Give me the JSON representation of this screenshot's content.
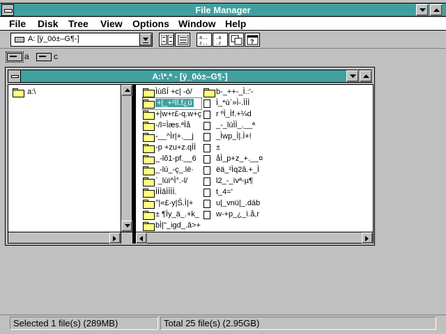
{
  "app": {
    "title": "File Manager",
    "colors": {
      "titlebar": "#40a0a0",
      "face": "#c0c0c0",
      "selection": "#40a0a0"
    }
  },
  "menu": [
    "File",
    "Disk",
    "Tree",
    "View",
    "Options",
    "Window",
    "Help"
  ],
  "toolbar": {
    "drive_select_value": "A: [ÿ_0ó±–G¶-]",
    "buttons": [
      {
        "icon": "view-tree-directory-icon"
      },
      {
        "icon": "view-directory-only-icon"
      },
      {
        "icon": "sort-by-name-icon"
      },
      {
        "icon": "sort-by-type-icon"
      },
      {
        "icon": "new-window-icon"
      },
      {
        "icon": "view-all-file-details-icon"
      }
    ]
  },
  "drives": [
    {
      "label": "a",
      "selected": true
    },
    {
      "label": "c",
      "selected": false
    }
  ],
  "window": {
    "title": "A:\\*.* - [ÿ_0ó±–G¶-]",
    "tree": {
      "root": "a:\\"
    },
    "files_col1": [
      {
        "name": "ÌùßÍ +c| -ó/",
        "type": "folder"
      },
      {
        "name": "+|_+²ÌÌ.f¿ú",
        "type": "folder",
        "selected": true
      },
      {
        "name": "+|w+r£-q.w+ç",
        "type": "folder"
      },
      {
        "name": "-/l=Ìæs.ªÌå",
        "type": "folder"
      },
      {
        "name": "-__^Ìr|+.__j",
        "type": "folder"
      },
      {
        "name": "-p +zu+z.qÌÌ",
        "type": "folder"
      },
      {
        "name": "_-lõ1-pf.__6",
        "type": "folder"
      },
      {
        "name": "_-lú_-ç_.lë·",
        "type": "folder"
      },
      {
        "name": "`_lùï^Ì°.-l/",
        "type": "folder"
      },
      {
        "name": "ÌÌÌâÌÌÌÌ.",
        "type": "folder"
      },
      {
        "name": "°|«£-y|Š.Ì|+",
        "type": "folder"
      },
      {
        "name": "± ¶Ìy_ä_.+k_",
        "type": "folder"
      },
      {
        "name": "bÌ|\"_igd_.â>+",
        "type": "folder"
      }
    ],
    "files_col2": [
      {
        "name": "b-_++-_Ì.:'-",
        "type": "folder"
      },
      {
        "name": "Ì_*ù`»Ì-.ÌÌÌ",
        "type": "file"
      },
      {
        "name": "r ºÌ_Ìf.+¼d",
        "type": "file"
      },
      {
        "name": "_-_lúÌÌ_.__ª",
        "type": "file"
      },
      {
        "name": "_Ìwp_Ì|.Ì+!",
        "type": "file"
      },
      {
        "name": "±",
        "type": "file"
      },
      {
        "name": "åÌ_p+z_+.__¤",
        "type": "file"
      },
      {
        "name": "ëä_²Ìq2â.+_Ì",
        "type": "file"
      },
      {
        "name": "l2_-_ïvª-µ¶",
        "type": "file"
      },
      {
        "name": "t_4='",
        "type": "file"
      },
      {
        "name": "u|_vnü|_.dáb",
        "type": "file"
      },
      {
        "name": "w-+p_¿_ì.å,r",
        "type": "file"
      }
    ]
  },
  "status": {
    "selected": "Selected 1 file(s) (289MB)",
    "total": "Total 25 file(s) (2.95GB)"
  }
}
